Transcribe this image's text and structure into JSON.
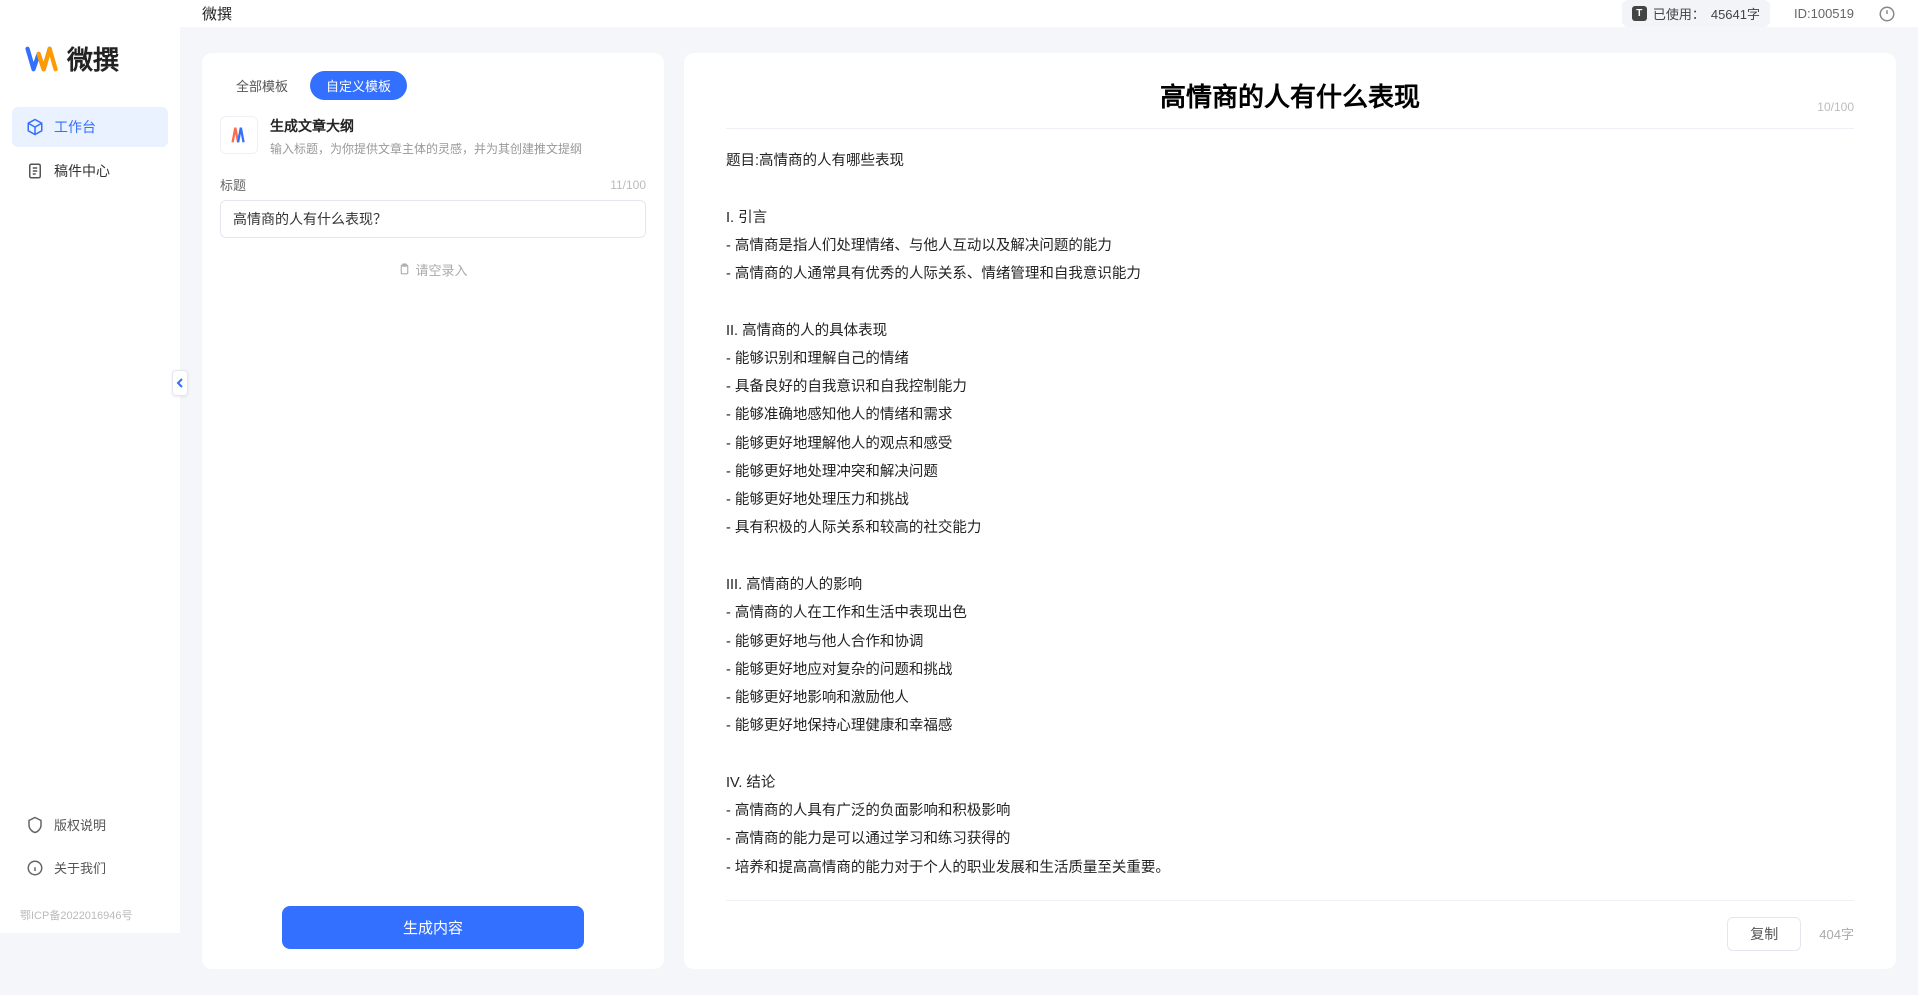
{
  "app": {
    "name": "微撰",
    "title_bar": "微撰"
  },
  "topbar": {
    "usage_label": "已使用：",
    "usage_value": "45641字",
    "id_label": "ID:100519"
  },
  "sidebar": {
    "items": [
      {
        "label": "工作台",
        "icon": "cube",
        "active": true
      },
      {
        "label": "稿件中心",
        "icon": "doc",
        "active": false
      }
    ],
    "bottom": [
      {
        "label": "版权说明",
        "icon": "shield"
      },
      {
        "label": "关于我们",
        "icon": "info"
      }
    ],
    "icp": "鄂ICP备2022016946号"
  },
  "left": {
    "tabs": [
      {
        "label": "全部模板",
        "active": false
      },
      {
        "label": "自定义模板",
        "active": true
      }
    ],
    "template": {
      "name": "生成文章大纲",
      "desc": "输入标题，为你提供文章主体的灵感，并为其创建推文提纲"
    },
    "form": {
      "title_label": "标题",
      "title_counter": "11/100",
      "title_value": "高情商的人有什么表现？",
      "empty_hint": "请空录入"
    },
    "generate": "生成内容"
  },
  "output": {
    "title": "高情商的人有什么表现",
    "title_counter": "10/100",
    "body": "题目:高情商的人有哪些表现\n\nI. 引言\n- 高情商是指人们处理情绪、与他人互动以及解决问题的能力\n- 高情商的人通常具有优秀的人际关系、情绪管理和自我意识能力\n\nII. 高情商的人的具体表现\n- 能够识别和理解自己的情绪\n- 具备良好的自我意识和自我控制能力\n- 能够准确地感知他人的情绪和需求\n- 能够更好地理解他人的观点和感受\n- 能够更好地处理冲突和解决问题\n- 能够更好地处理压力和挑战\n- 具有积极的人际关系和较高的社交能力\n\nIII. 高情商的人的影响\n- 高情商的人在工作和生活中表现出色\n- 能够更好地与他人合作和协调\n- 能够更好地应对复杂的问题和挑战\n- 能够更好地影响和激励他人\n- 能够更好地保持心理健康和幸福感\n\nIV. 结论\n- 高情商的人具有广泛的负面影响和积极影响\n- 高情商的能力是可以通过学习和练习获得的\n- 培养和提高高情商的能力对于个人的职业发展和生活质量至关重要。",
    "copy": "复制",
    "word_count": "404字"
  }
}
